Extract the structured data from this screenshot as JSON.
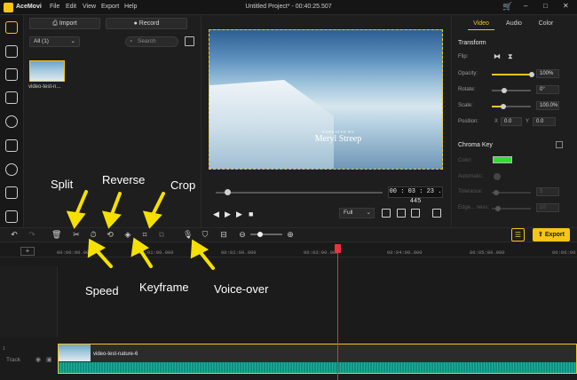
{
  "titlebar": {
    "brand": "AceMovi",
    "menu": [
      "File",
      "Edit",
      "View",
      "Export",
      "Help"
    ],
    "title": "Untitled Project* - 00:40:25.507",
    "controls": [
      "–",
      "□",
      "✕"
    ]
  },
  "media": {
    "import_label": "Import",
    "record_label": "Record",
    "filter": "All (1)",
    "search_placeholder": "Search",
    "item_label": "video-test-n..."
  },
  "preview": {
    "watermark_small": "NARRATED BY",
    "watermark": "Meryl Streep",
    "time": "00 : 03 : 23 . 445",
    "quality": "Full",
    "progress_fraction": 0.07
  },
  "properties": {
    "tabs": [
      "Video",
      "Audio",
      "Color"
    ],
    "transform_title": "Transform",
    "flip_label": "Flip:",
    "opacity_label": "Opacity:",
    "opacity_value": "100%",
    "rotate_label": "Rotate:",
    "rotate_value": "0°",
    "scale_label": "Scale:",
    "scale_value": "100.0%",
    "position_label": "Position:",
    "pos_x_label": "X",
    "pos_x_value": "0.0",
    "pos_y_label": "Y",
    "pos_y_value": "0.0",
    "chroma_title": "Chroma Key",
    "color_label": "Color:",
    "automatic_label": "Automatic:",
    "tolerance_label": "Tolerance:",
    "tolerance_value": "5",
    "edge_label": "Edge... ness:",
    "edge_value": "10"
  },
  "toolbar": {
    "export_label": "Export"
  },
  "ruler": {
    "ticks": [
      "00:00:00.000",
      "00:01:00.000",
      "00:02:00.000",
      "00:03:00.000",
      "00:04:00.000",
      "00:05:00.000",
      "00:06:00"
    ]
  },
  "timeline": {
    "track_label": "Track",
    "track_num": "1",
    "clip_name": "video-test-nature-6"
  },
  "annotations": {
    "split": "Split",
    "reverse": "Reverse",
    "crop": "Crop",
    "speed": "Speed",
    "keyframe": "Keyframe",
    "voiceover": "Voice-over"
  },
  "colors": {
    "accent": "#f5c518",
    "playhead": "#e8323c",
    "chroma": "#33dd33"
  }
}
